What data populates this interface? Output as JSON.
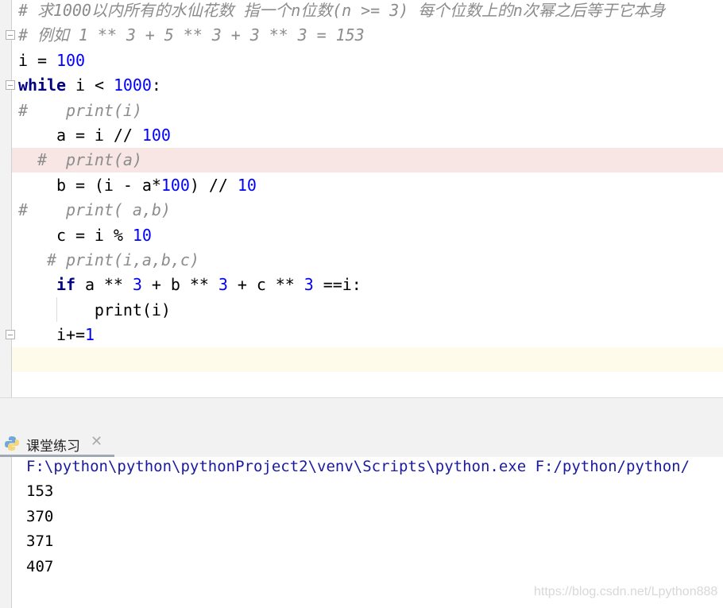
{
  "colors": {
    "comment": "#8c8c8c",
    "keyword": "#000080",
    "number": "#0000ff",
    "highlight_line": "#f7e6e3",
    "current_line": "#fefbea"
  },
  "editor": {
    "lines": [
      [
        [
          "c",
          "# 求1000以内所有的水仙花数 指一个n位数(n >= 3) 每个位数上的n次幂之后等于它本身"
        ]
      ],
      [
        [
          "c",
          "# 例如 1 ** 3 + 5 ** 3 + 3 ** 3 = 153"
        ]
      ],
      [
        [
          "t",
          "i = "
        ],
        [
          "n",
          "100"
        ]
      ],
      [
        [
          "k",
          "while"
        ],
        [
          "t",
          " i < "
        ],
        [
          "n",
          "1000"
        ],
        [
          "t",
          ":"
        ]
      ],
      [
        [
          "c",
          "#    print(i)"
        ]
      ],
      [
        [
          "t",
          "    a = i // "
        ],
        [
          "n",
          "100"
        ]
      ],
      [
        [
          "c",
          "  #  print(a)"
        ]
      ],
      [
        [
          "t",
          "    b = (i - a*"
        ],
        [
          "n",
          "100"
        ],
        [
          "t",
          ") // "
        ],
        [
          "n",
          "10"
        ]
      ],
      [
        [
          "c",
          "#    print( a,b)"
        ]
      ],
      [
        [
          "t",
          "    c = i % "
        ],
        [
          "n",
          "10"
        ]
      ],
      [
        [
          "c",
          "   # print(i,a,b,c)"
        ]
      ],
      [
        [
          "t",
          "    "
        ],
        [
          "k",
          "if"
        ],
        [
          "t",
          " a ** "
        ],
        [
          "n",
          "3"
        ],
        [
          "t",
          " + b ** "
        ],
        [
          "n",
          "3"
        ],
        [
          "t",
          " + c ** "
        ],
        [
          "n",
          "3"
        ],
        [
          "t",
          " ==i:"
        ]
      ],
      [
        [
          "t",
          "        print(i)"
        ]
      ],
      [
        [
          "t",
          "    i+="
        ],
        [
          "n",
          "1"
        ]
      ],
      [
        [
          "t",
          ""
        ]
      ]
    ]
  },
  "run_panel": {
    "tab": {
      "label": "课堂练习",
      "icon": "python-icon",
      "close_icon": "close-icon"
    },
    "command": "F:\\python\\python\\pythonProject2\\venv\\Scripts\\python.exe F:/python/python/",
    "output": [
      "153",
      "370",
      "371",
      "407"
    ]
  },
  "watermark": "https://blog.csdn.net/Lpython888"
}
